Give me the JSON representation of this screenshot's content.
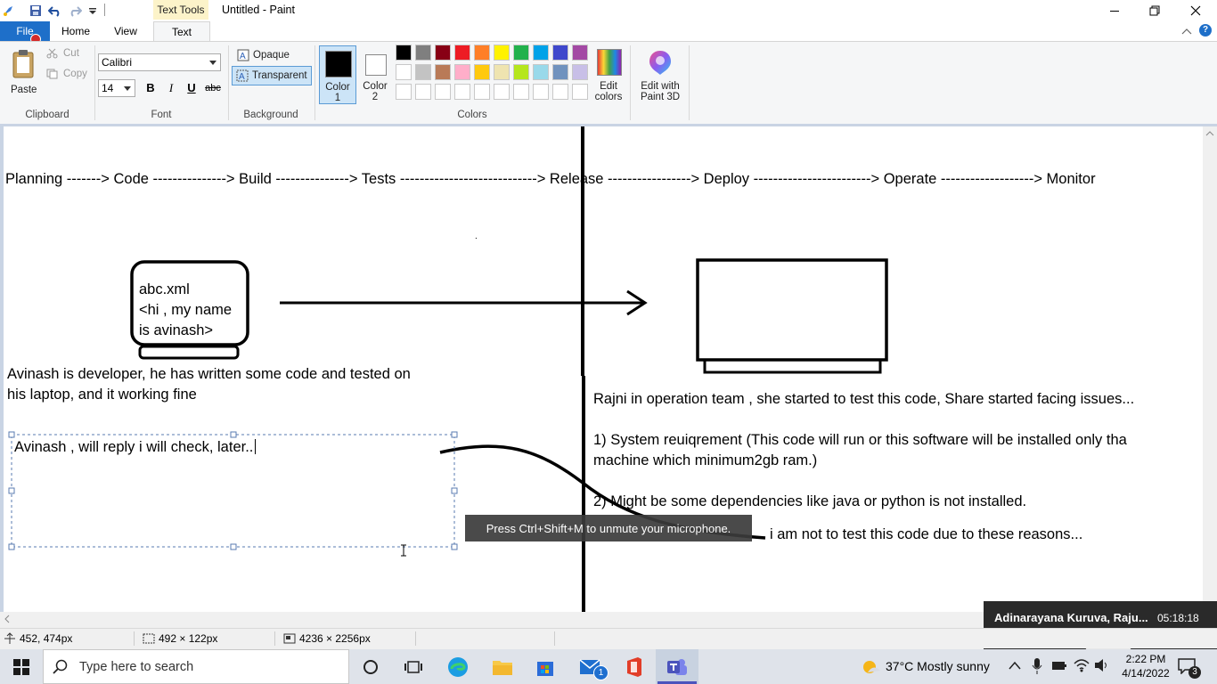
{
  "window": {
    "contextual_tab": "Text Tools",
    "title": "Untitled - Paint"
  },
  "tabs": {
    "file": "File",
    "home": "Home",
    "view": "View",
    "text": "Text"
  },
  "clipboard": {
    "paste": "Paste",
    "cut": "Cut",
    "copy": "Copy",
    "group": "Clipboard"
  },
  "font": {
    "family": "Calibri",
    "size": "14",
    "bold": "B",
    "italic": "I",
    "underline": "U",
    "strike": "abc",
    "group": "Font"
  },
  "background": {
    "opaque": "Opaque",
    "transparent": "Transparent",
    "group": "Background"
  },
  "colors": {
    "color1_label": "Color",
    "color1_num": "1",
    "color2_label": "Color",
    "color2_num": "2",
    "color1_value": "#000000",
    "color2_value": "#ffffff",
    "palette_row1": [
      "#000000",
      "#7f7f7f",
      "#880015",
      "#ed1c24",
      "#ff7f27",
      "#fff200",
      "#22b14c",
      "#00a2e8",
      "#3f48cc",
      "#a349a4"
    ],
    "palette_row2": [
      "#ffffff",
      "#c3c3c3",
      "#b97a57",
      "#ffaec9",
      "#ffc90e",
      "#efe4b0",
      "#b5e61d",
      "#99d9ea",
      "#7092be",
      "#c8bfe7"
    ],
    "edit_colors_line1": "Edit",
    "edit_colors_line2": "colors",
    "paint3d_line1": "Edit with",
    "paint3d_line2": "Paint 3D",
    "group": "Colors"
  },
  "canvas": {
    "pipeline": "Planning    ------->   Code  --------------->  Build  --------------->  Tests  ---------------------------->  Release  ----------------->  Deploy  ------------------------>  Operate  ------------------->  Monitor",
    "dot": ".",
    "file_line1": "abc.xml",
    "file_line2": "<hi , my name",
    "file_line3": "is avinash>",
    "dev_line1": "Avinash is developer, he has written some code and tested on",
    "dev_line2": "his laptop, and it working fine",
    "textbox": "Avinash , will reply i will check, later..",
    "ops_line1": "Rajni in operation team , she started to test this code, Share started facing issues...",
    "ops_line2": "1) System reuiqrement (This code will run or this software will be installed only tha",
    "ops_line3": "machine which minimum2gb ram.)",
    "ops_line4": "2) Might be some dependencies like java or python is not installed.",
    "ops_line5": "i am not to test this code due to these reasons..."
  },
  "tooltip": "Press Ctrl+Shift+M to unmute your microphone.",
  "teams_popup": {
    "name": "Adinarayana Kuruva, Raju...",
    "time": "05:18:18"
  },
  "status": {
    "cursor": "452, 474px",
    "selection": "492 × 122px",
    "canvas_size": "4236 × 2256px"
  },
  "taskbar": {
    "search_placeholder": "Type here to search",
    "weather": "37°C  Mostly sunny",
    "time": "2:22 PM",
    "date": "4/14/2022",
    "mail_badge": "1",
    "notif_badge": "3"
  }
}
